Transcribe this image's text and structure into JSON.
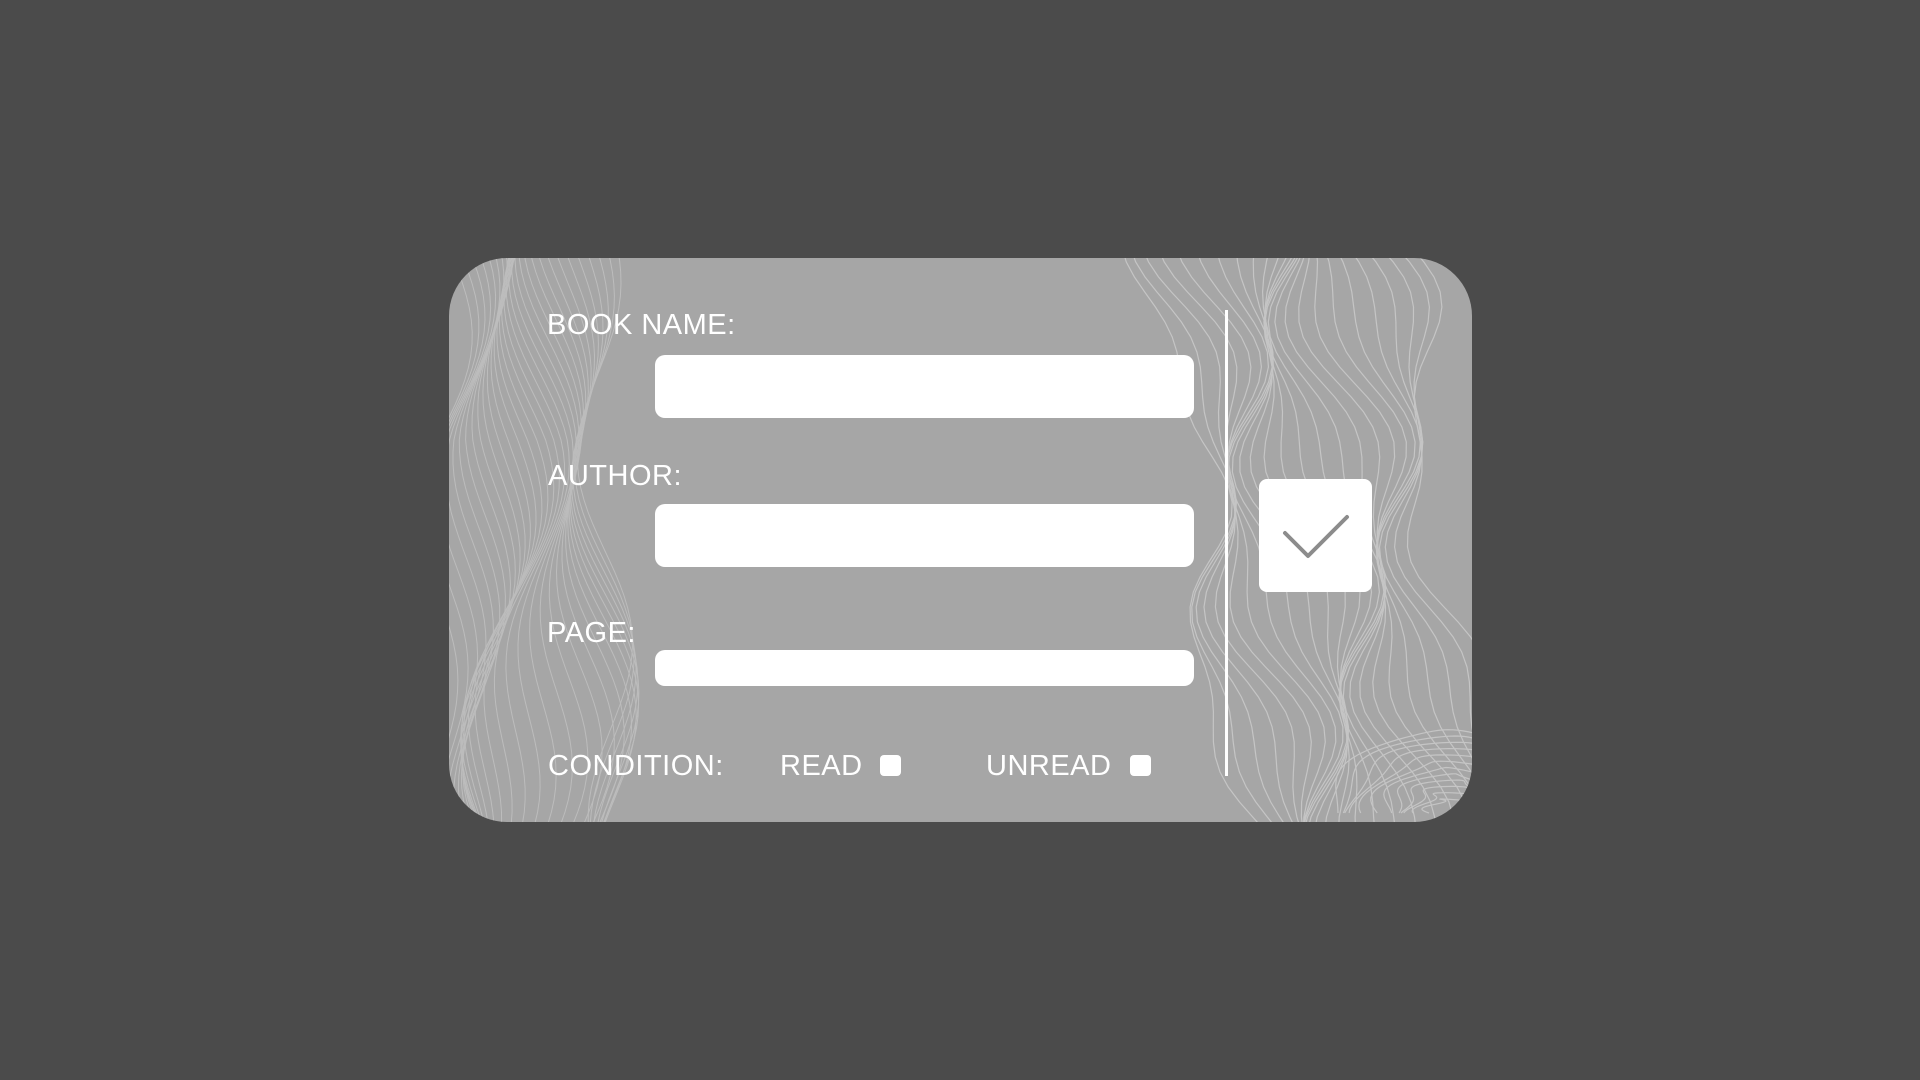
{
  "form": {
    "book_name_label": "BOOK NAME:",
    "book_name_value": "",
    "author_label": "AUTHOR:",
    "author_value": "",
    "page_label": "PAGE:",
    "page_value": "",
    "condition_label": "CONDITION:",
    "read_label": "READ",
    "read_checked": false,
    "unread_label": "UNREAD",
    "unread_checked": false
  },
  "confirm": {
    "icon": "checkmark-icon"
  },
  "colors": {
    "background": "#4b4b4b",
    "card": "#a6a6a6",
    "field": "#ffffff",
    "text": "#ffffff",
    "checkmark": "#8c8c8c"
  }
}
